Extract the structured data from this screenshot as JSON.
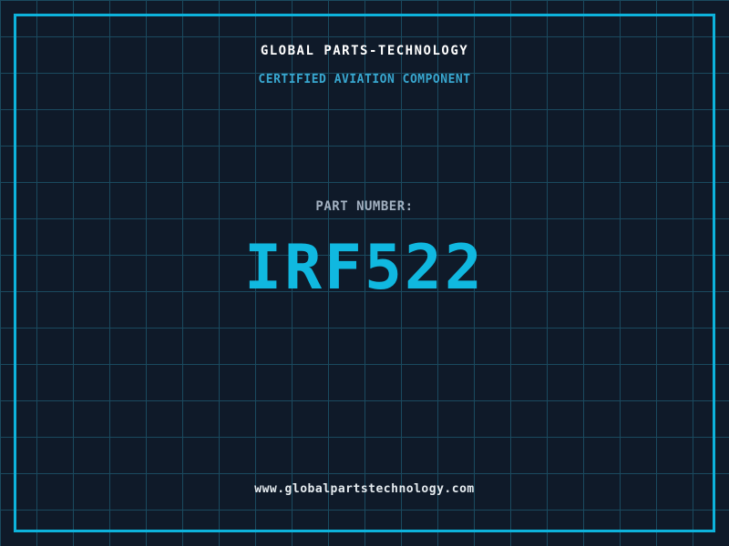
{
  "poster": {
    "company": "GLOBAL PARTS-TECHNOLOGY",
    "subtitle": "CERTIFIED AVIATION COMPONENT",
    "part_number_label": "PART NUMBER:",
    "part_number": "IRF522",
    "website": "www.globalpartstechnology.com"
  },
  "colors": {
    "background": "#0f1a29",
    "grid_line": "#1a4a5f",
    "frame_border": "#0db3dc",
    "company_text": "#ffffff",
    "subtitle_text": "#38a7d0",
    "part_label_text": "#a2b0c0",
    "part_number_text": "#10b8e0",
    "website_text": "#e6ecf0"
  }
}
